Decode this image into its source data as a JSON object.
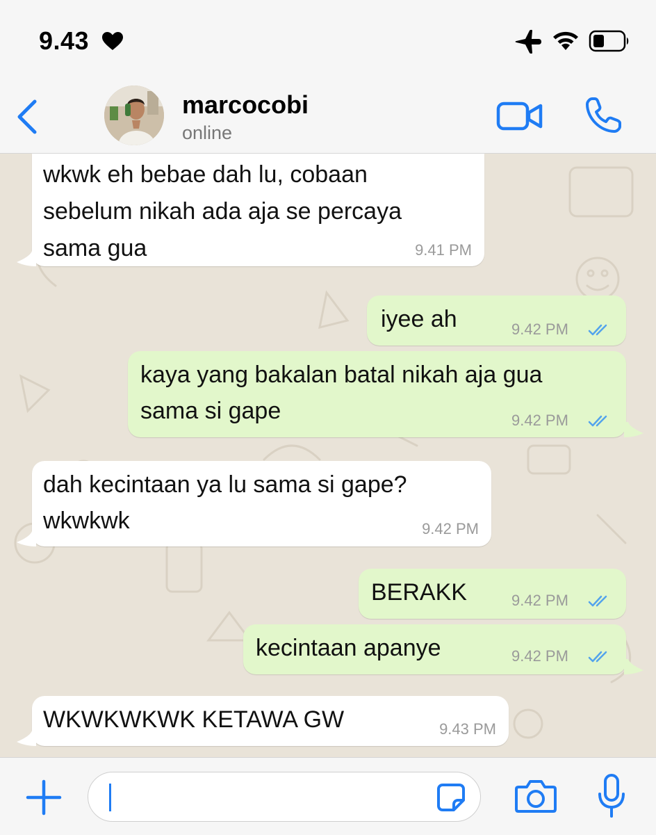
{
  "status_bar": {
    "time": "9.43"
  },
  "header": {
    "contact_name": "marcocobi",
    "contact_status": "online"
  },
  "messages": [
    {
      "direction": "incoming",
      "lines": [
        "wkwk eh bebae dah lu, cobaan",
        "sebelum nikah ada aja se percaya",
        "sama gua"
      ],
      "time": "9.41 PM"
    },
    {
      "direction": "outgoing",
      "lines": [
        "iyee ah"
      ],
      "time": "9.42 PM",
      "read": true
    },
    {
      "direction": "outgoing",
      "lines": [
        "kaya yang bakalan batal nikah aja gua",
        "sama si gape"
      ],
      "time": "9.42 PM",
      "read": true
    },
    {
      "direction": "incoming",
      "lines": [
        "dah kecintaan ya lu sama si gape?",
        "wkwkwk"
      ],
      "time": "9.42 PM"
    },
    {
      "direction": "outgoing",
      "lines": [
        "BERAKK"
      ],
      "time": "9.42 PM",
      "read": true
    },
    {
      "direction": "outgoing",
      "lines": [
        "kecintaan apanye"
      ],
      "time": "9.42 PM",
      "read": true
    },
    {
      "direction": "incoming",
      "lines": [
        "WKWKWKWK KETAWA GW"
      ],
      "time": "9.43 PM"
    }
  ],
  "composer": {
    "text": ""
  },
  "icons": {
    "status": [
      "heart-icon",
      "airplane-icon",
      "wifi-icon",
      "battery-icon"
    ],
    "header": [
      "back-chevron-icon",
      "video-call-icon",
      "phone-call-icon"
    ],
    "composer": [
      "plus-icon",
      "sticker-icon",
      "camera-icon",
      "microphone-icon"
    ]
  },
  "colors": {
    "accent": "#1f7cf4",
    "incoming_bubble": "#ffffff",
    "outgoing_bubble": "#e2f7cb",
    "chat_background": "#e9e3d8",
    "read_ticks": "#53a3ec"
  }
}
